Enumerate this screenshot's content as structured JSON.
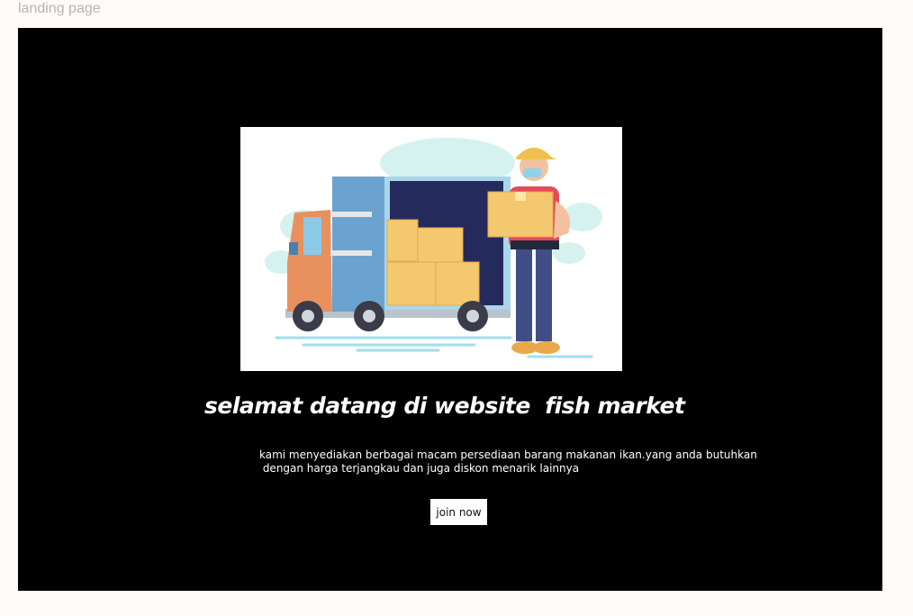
{
  "page": {
    "label": "landing page"
  },
  "hero": {
    "image_icon": "delivery-truck-illustration",
    "headline": "selamat datang di website  fish market",
    "description_lines": [
      "kami menyediakan berbagai macam persediaan barang makanan ikan.yang anda butuhkan",
      " dengan harga terjangkau dan juga diskon menarik lainnya"
    ],
    "join_label": "join now"
  },
  "colors": {
    "page_background": "#fffbf9",
    "frame_background": "#000000",
    "text_on_dark": "#ffffff",
    "button_background": "#ffffff"
  }
}
